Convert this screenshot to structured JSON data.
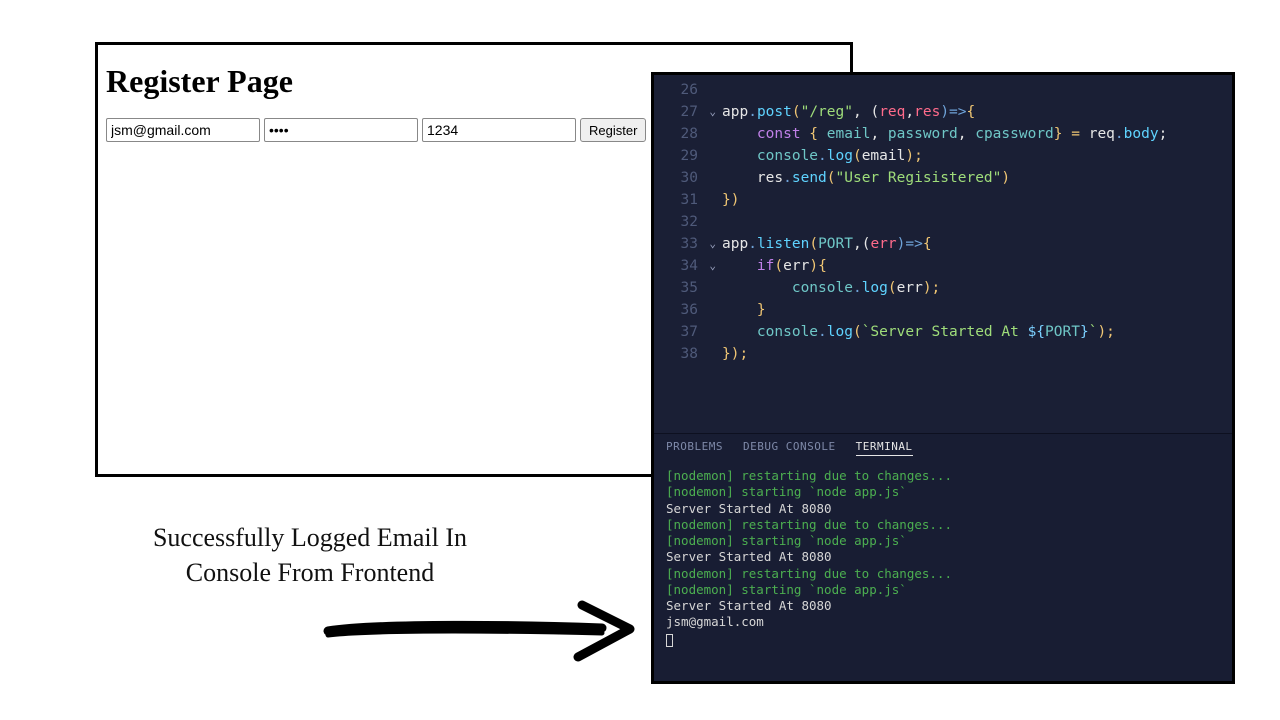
{
  "browser": {
    "heading": "Register Page",
    "email_value": "jsm@gmail.com",
    "password_value": "••••",
    "cpassword_value": "1234",
    "register_label": "Register"
  },
  "caption": {
    "line1": "Successfully Logged Email In",
    "line2": "Console From Frontend"
  },
  "editor": {
    "gutter": [
      "26",
      "27",
      "28",
      "29",
      "30",
      "31",
      "32",
      "33",
      "34",
      "35",
      "36",
      "37",
      "38"
    ],
    "code": {
      "l27a": "app",
      "l27b": ".",
      "l27c": "post",
      "l27d": "(",
      "l27e": "\"/reg\"",
      "l27f": ", (",
      "l27g": "req",
      "l27h": ",",
      "l27i": "res",
      "l27j": ")=>",
      "l27k": "{",
      "l28a": "const",
      "l28b": " { ",
      "l28c": "email",
      "l28d": ", ",
      "l28e": "password",
      "l28f": ", ",
      "l28g": "cpassword",
      "l28h": "} = ",
      "l28i": "req",
      "l28j": ".",
      "l28k": "body",
      "l28l": ";",
      "l29a": "console",
      "l29b": ".",
      "l29c": "log",
      "l29d": "(",
      "l29e": "email",
      "l29f": ");",
      "l30a": "res",
      "l30b": ".",
      "l30c": "send",
      "l30d": "(",
      "l30e": "\"User Regisistered\"",
      "l30f": ")",
      "l31a": "})",
      "l33a": "app",
      "l33b": ".",
      "l33c": "listen",
      "l33d": "(",
      "l33e": "PORT",
      "l33f": ",(",
      "l33g": "err",
      "l33h": ")=>",
      "l33i": "{",
      "l34a": "if",
      "l34b": "(",
      "l34c": "err",
      "l34d": ")",
      "l34e": "{",
      "l35a": "console",
      "l35b": ".",
      "l35c": "log",
      "l35d": "(",
      "l35e": "err",
      "l35f": ");",
      "l36a": "}",
      "l37a": "console",
      "l37b": ".",
      "l37c": "log",
      "l37d": "(",
      "l37e": "`Server Started At ",
      "l37f": "${",
      "l37g": "PORT",
      "l37h": "}",
      "l37i": "`",
      "l37j": ");",
      "l38a": "});"
    }
  },
  "panel": {
    "tab_problems": "PROBLEMS",
    "tab_debug": "DEBUG CONSOLE",
    "tab_terminal": "TERMINAL"
  },
  "terminal": {
    "lines": [
      {
        "cls": "t-green",
        "text": "[nodemon] restarting due to changes..."
      },
      {
        "cls": "t-green",
        "text": "[nodemon] starting `node app.js`"
      },
      {
        "cls": "t-white",
        "text": "Server Started At 8080"
      },
      {
        "cls": "t-green",
        "text": "[nodemon] restarting due to changes..."
      },
      {
        "cls": "t-green",
        "text": "[nodemon] starting `node app.js`"
      },
      {
        "cls": "t-white",
        "text": "Server Started At 8080"
      },
      {
        "cls": "t-green",
        "text": "[nodemon] restarting due to changes..."
      },
      {
        "cls": "t-green",
        "text": "[nodemon] starting `node app.js`"
      },
      {
        "cls": "t-white",
        "text": "Server Started At 8080"
      },
      {
        "cls": "t-white",
        "text": "jsm@gmail.com"
      }
    ]
  }
}
